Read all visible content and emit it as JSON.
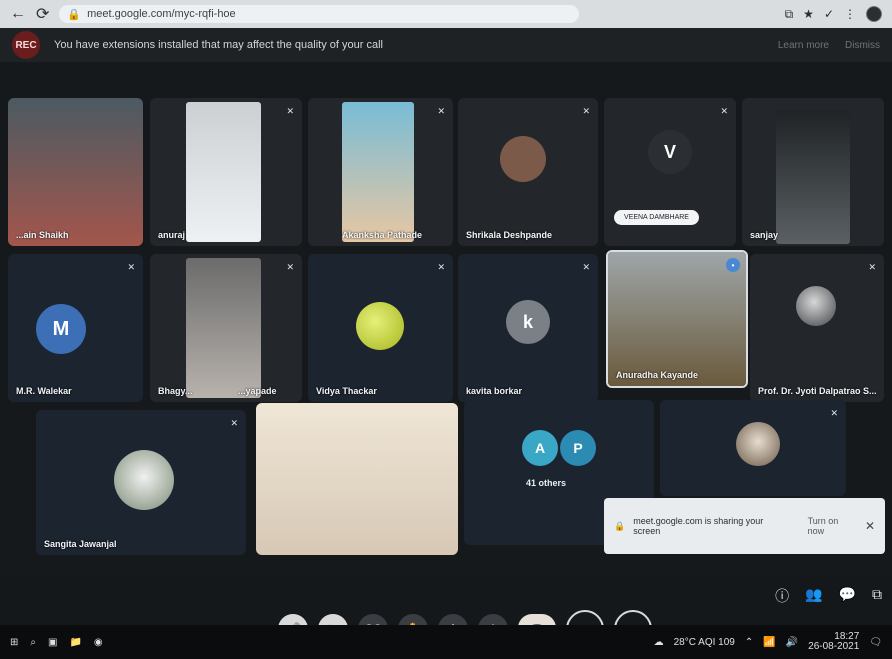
{
  "browser": {
    "url": "meet.google.com/myc-rqfi-hoe",
    "actions": [
      "⟳",
      "★",
      "⋮"
    ]
  },
  "banner": {
    "rec_label": "REC",
    "message": "You have extensions installed that may affect the quality of your call",
    "right_1": "Learn more",
    "right_2": "Dismiss"
  },
  "tiles": {
    "t1_name": "...ain Shaikh",
    "t2_name": "anuraj",
    "t3_name": "Akanksha Pathade",
    "t4_name": "Shrikala Deshpande",
    "t5_name": "VEENA DAMBHARE",
    "t5_initial": "V",
    "t6_name": "sanjay",
    "t7_name": "M.R. Walekar",
    "t7_initial": "M",
    "t8_name": "Bhagy...",
    "t8_name2": "...yapade",
    "t9_name": "Vidya Thackar",
    "t10_name": "kavita borkar",
    "t10_initial": "k",
    "t11_name": "Anuradha Kayande",
    "t12_name": "Prof. Dr. Jyoti Dalpatrao S...",
    "t13_name": "Sangita Jawanjal",
    "t15_initials_a": "A",
    "t15_initials_p": "P",
    "t15_label": "41 others"
  },
  "toast": {
    "text": "meet.google.com is sharing your screen",
    "action": "Turn on now",
    "close": "✕"
  },
  "bottom": {
    "meeting_code": "myc-rqfi-hoe"
  },
  "taskbar": {
    "weather": "28°C AQI 109",
    "time": "18:27",
    "date": "26-08-2021"
  }
}
